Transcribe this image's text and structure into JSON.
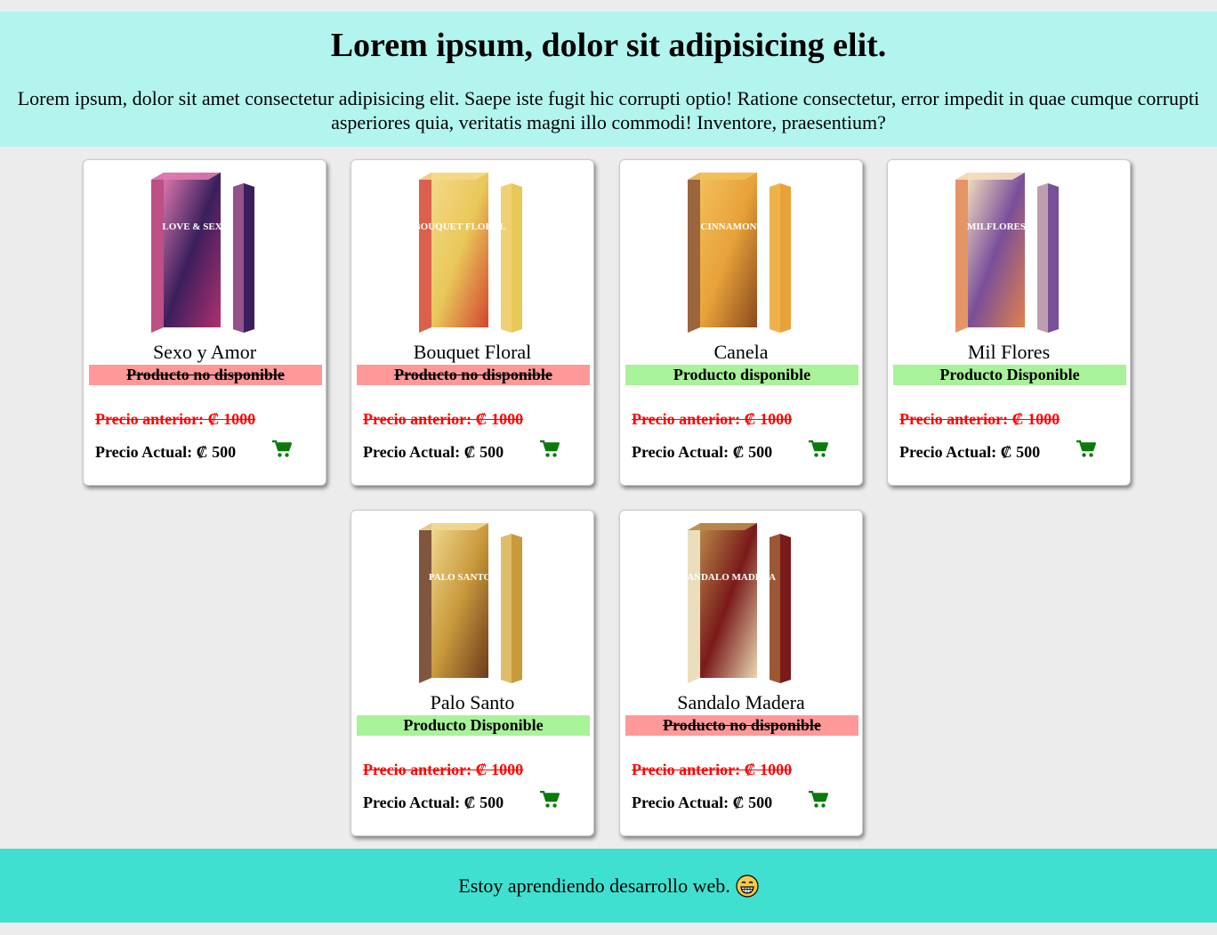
{
  "header": {
    "title": "Lorem ipsum, dolor sit adipisicing elit.",
    "intro": "Lorem ipsum, dolor sit amet consectetur adipisicing elit. Saepe iste fugit hic corrupti optio! Ratione consectetur, error impedit in quae cumque corrupti asperiores quia, veritatis magni illo commodi! Inventore, praesentium?"
  },
  "products": [
    {
      "name": "Sexo y Amor",
      "status": "Producto no disponible",
      "available": false,
      "previous_price": "Precio anterior: ₡ 1000",
      "current_price": "Precio Actual: ₡ 500",
      "box_label": "LOVE & SEX",
      "box_colors": [
        "#3a1f5c",
        "#b0306e",
        "#e07ab0"
      ]
    },
    {
      "name": "Bouquet Floral",
      "status": "Producto no disponible",
      "available": false,
      "previous_price": "Precio anterior: ₡ 1000",
      "current_price": "Precio Actual: ₡ 500",
      "box_label": "BOUQUET FLORAL",
      "box_colors": [
        "#e9c85a",
        "#d2452e",
        "#f4d98a"
      ]
    },
    {
      "name": "Canela",
      "status": "Producto disponible",
      "available": true,
      "previous_price": "Precio anterior: ₡ 1000",
      "current_price": "Precio Actual: ₡ 500",
      "box_label": "CINNAMON",
      "box_colors": [
        "#e8a23a",
        "#8a4a1c",
        "#f2c05a"
      ]
    },
    {
      "name": "Mil Flores",
      "status": "Producto Disponible",
      "available": true,
      "previous_price": "Precio anterior: ₡ 1000",
      "current_price": "Precio Actual: ₡ 500",
      "box_label": "MILFLORES",
      "box_colors": [
        "#7a4f9a",
        "#e0824a",
        "#f4e0c0"
      ]
    },
    {
      "name": "Palo Santo",
      "status": "Producto Disponible",
      "available": true,
      "previous_price": "Precio anterior: ₡ 1000",
      "current_price": "Precio Actual: ₡ 500",
      "box_label": "PALO SANTO",
      "box_colors": [
        "#c99a3c",
        "#6a3a1c",
        "#f0d890"
      ]
    },
    {
      "name": "Sandalo Madera",
      "status": "Producto no disponible",
      "available": false,
      "previous_price": "Precio anterior: ₡ 1000",
      "current_price": "Precio Actual: ₡ 500",
      "box_label": "SANDALO MADERA",
      "box_colors": [
        "#7a1a1a",
        "#e8d8b0",
        "#b88a4a"
      ]
    }
  ],
  "footer": {
    "message": "Estoy aprendiendo desarrollo web.",
    "emoji": "grinning-face-icon"
  },
  "colors": {
    "header_bg": "#b2f5ef",
    "footer_bg": "#40e0d0",
    "available_bg": "#a8f29a",
    "unavailable_bg": "#ff9999",
    "old_price": "#ff0000",
    "cart_icon": "#0a7a0a"
  }
}
